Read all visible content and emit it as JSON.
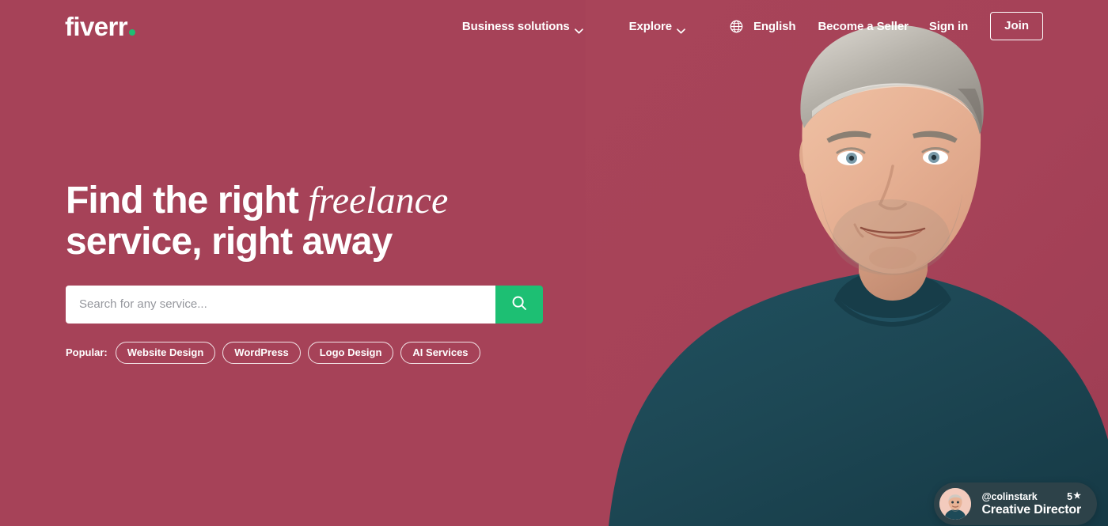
{
  "theme": {
    "background": "#a64258",
    "accent_green": "#1dbf73",
    "text_on_hero": "#ffffff",
    "shirt_teal": "#1e4a58",
    "card_dark": "#2d4249"
  },
  "navbar": {
    "logo_text": "fiverr",
    "logo_dot_icon": "dot-icon",
    "business_solutions": "Business solutions",
    "business_solutions_chevron": "chevron-down-icon",
    "explore": "Explore",
    "explore_chevron": "chevron-down-icon",
    "globe_icon": "globe-icon",
    "language": "English",
    "become_a_seller": "Become a Seller",
    "sign_in": "Sign in",
    "join": "Join"
  },
  "hero": {
    "headline_part1": "Find the right ",
    "headline_italic": "freelance",
    "headline_part2": "service, right away",
    "photo_alt": "smiling-man-grey-hair-teal-tshirt"
  },
  "search": {
    "placeholder": "Search for any service...",
    "value": "",
    "button_icon": "search-icon"
  },
  "popular": {
    "label": "Popular:",
    "tags": [
      "Website Design",
      "WordPress",
      "Logo Design",
      "AI Services"
    ]
  },
  "profile_card": {
    "avatar_icon": "avatar",
    "handle": "@colinstark",
    "rating": "5",
    "rating_star_icon": "star-icon",
    "title": "Creative Director"
  }
}
